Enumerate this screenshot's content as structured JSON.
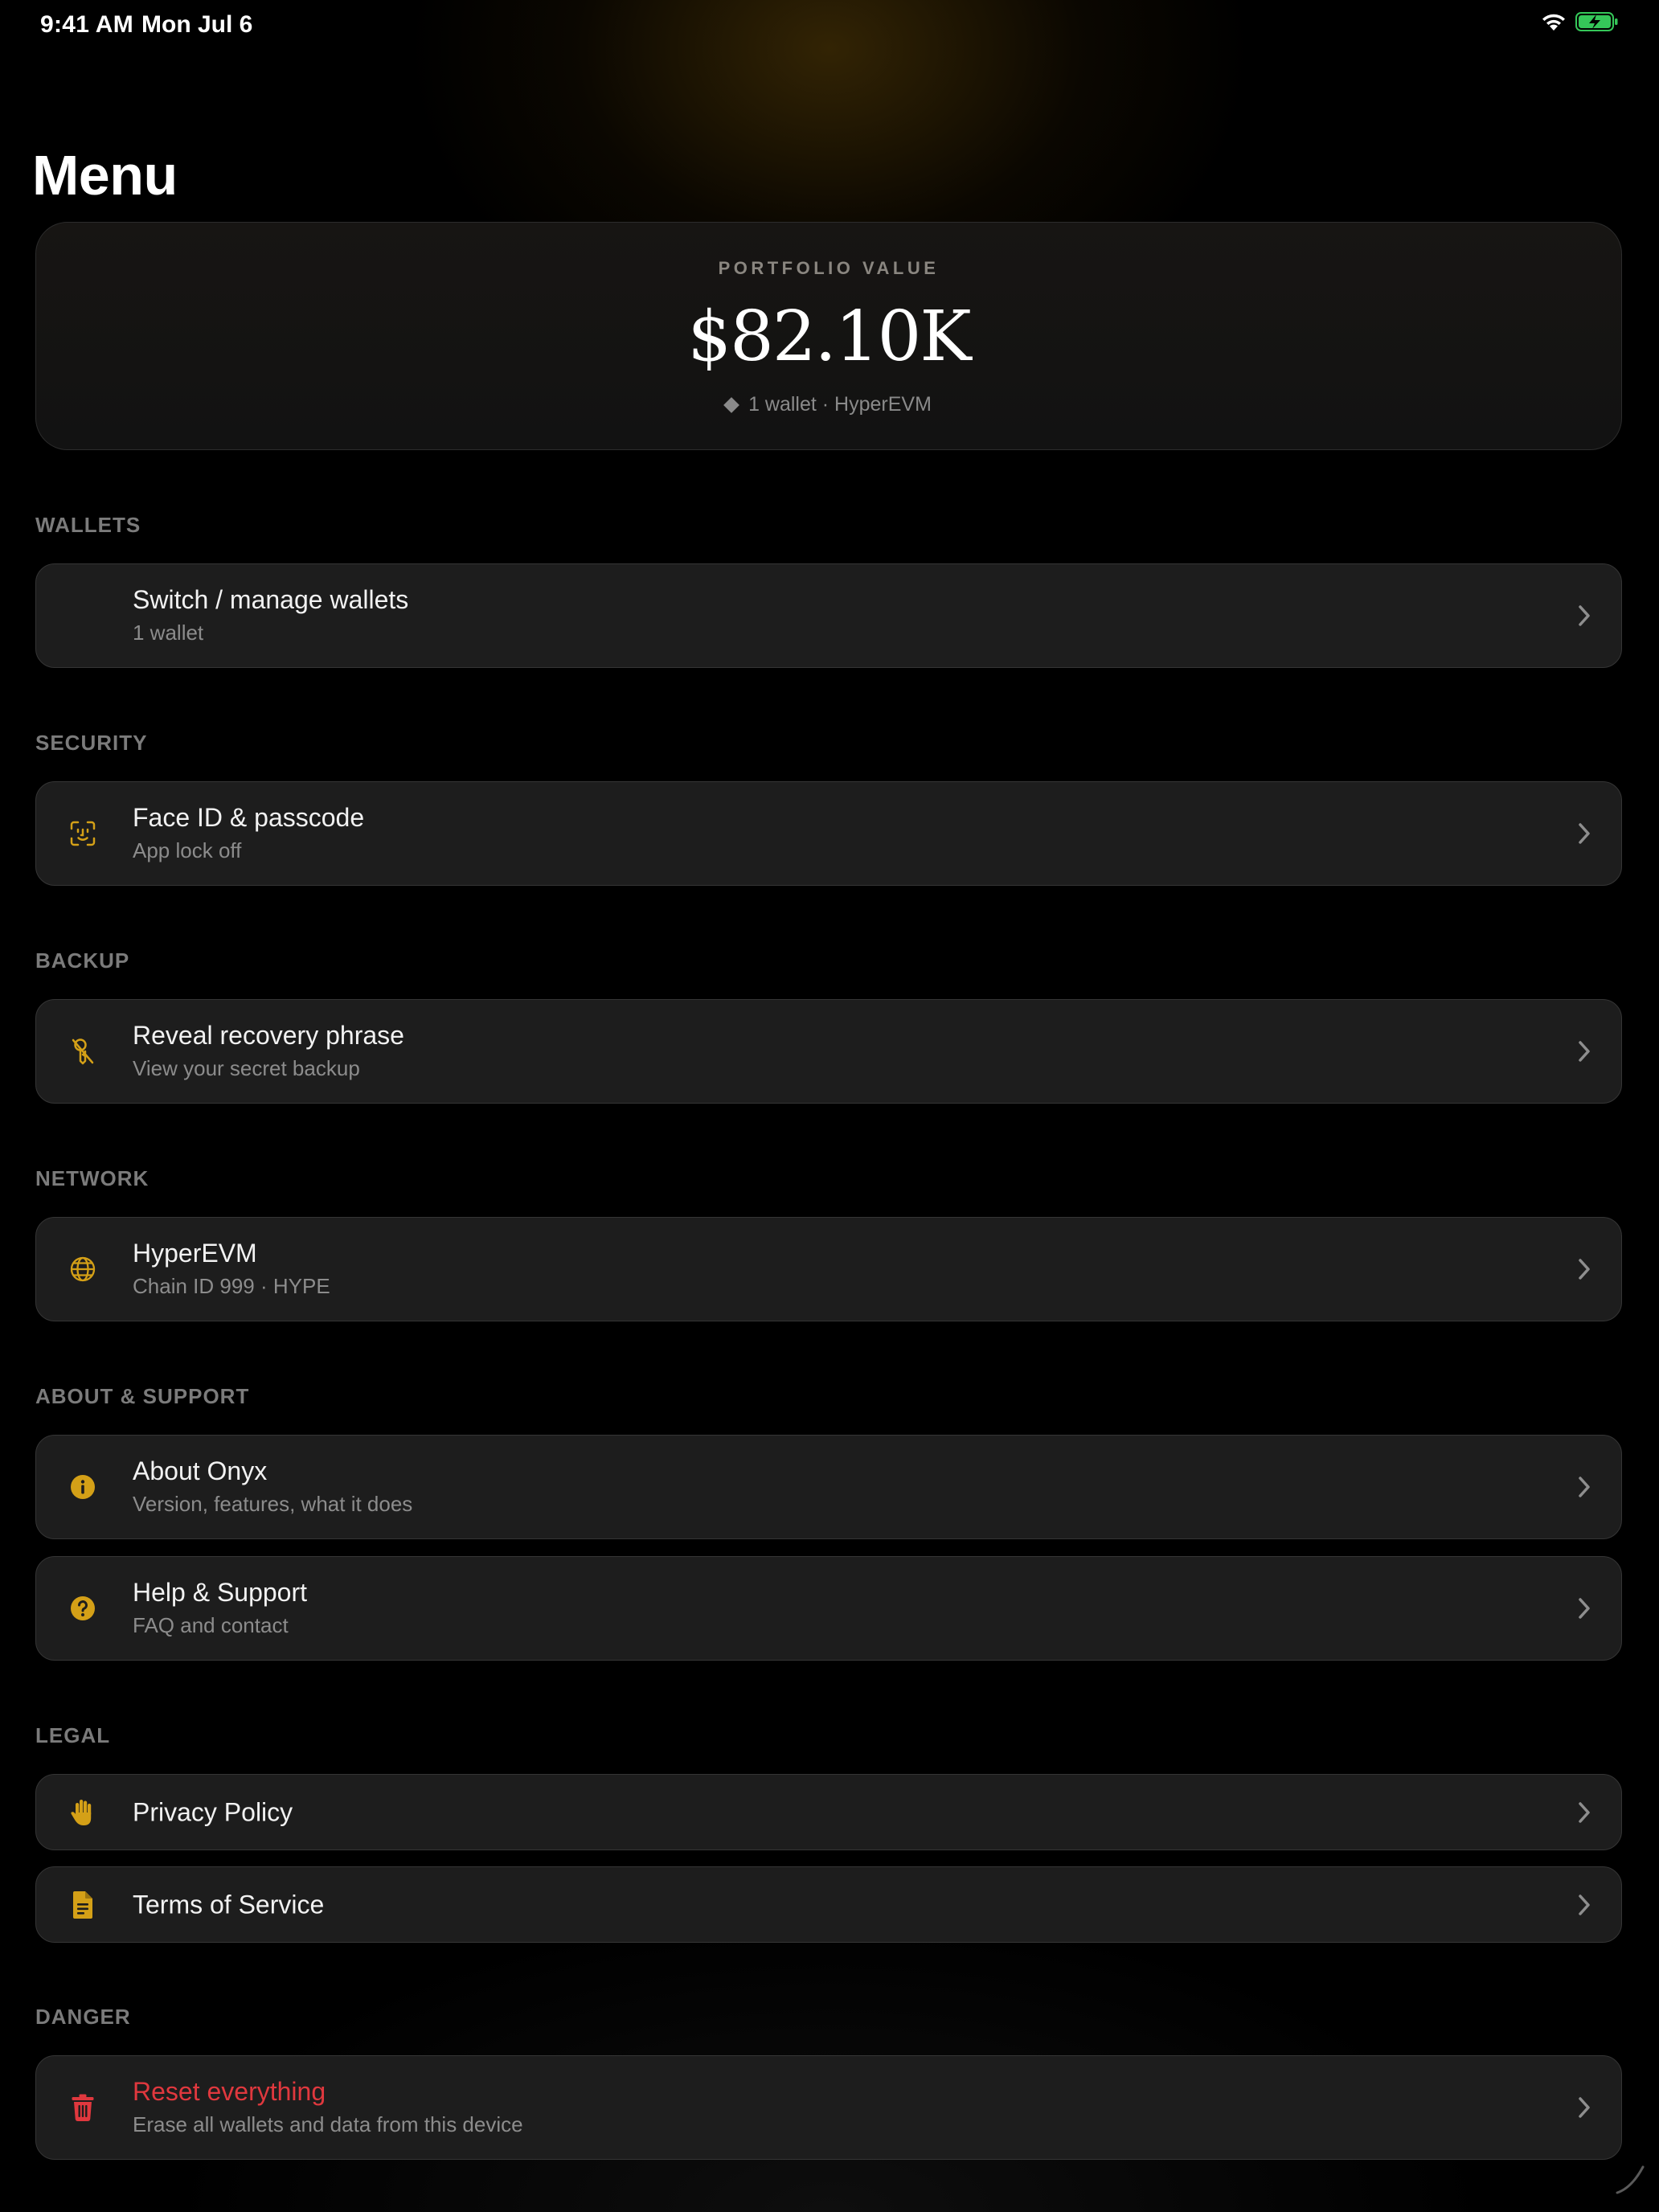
{
  "status_bar": {
    "time": "9:41 AM",
    "date": "Mon Jul 6"
  },
  "page_title": "Menu",
  "portfolio": {
    "label": "PORTFOLIO VALUE",
    "value": "$82.10K",
    "subtitle": "1 wallet · HyperEVM"
  },
  "colors": {
    "accent": "#d4a017",
    "danger": "#e0383e",
    "background": "#000000",
    "card": "#1d1d1d"
  },
  "sections": {
    "wallets": {
      "label": "WALLETS",
      "items": [
        {
          "title": "Switch / manage wallets",
          "subtitle": "1 wallet",
          "icon": "none"
        }
      ]
    },
    "security": {
      "label": "SECURITY",
      "items": [
        {
          "title": "Face ID & passcode",
          "subtitle": "App lock off",
          "icon": "face-id-icon"
        }
      ]
    },
    "backup": {
      "label": "BACKUP",
      "items": [
        {
          "title": "Reveal recovery phrase",
          "subtitle": "View your secret backup",
          "icon": "key-slash-icon"
        }
      ]
    },
    "network": {
      "label": "NETWORK",
      "items": [
        {
          "title": "HyperEVM",
          "subtitle": "Chain ID 999 · HYPE",
          "icon": "globe-icon"
        }
      ]
    },
    "about": {
      "label": "ABOUT & SUPPORT",
      "items": [
        {
          "title": "About Onyx",
          "subtitle": "Version, features, what it does",
          "icon": "info-icon"
        },
        {
          "title": "Help & Support",
          "subtitle": "FAQ and contact",
          "icon": "question-icon"
        }
      ]
    },
    "legal": {
      "label": "LEGAL",
      "items": [
        {
          "title": "Privacy Policy",
          "icon": "hand-icon"
        },
        {
          "title": "Terms of Service",
          "icon": "document-icon"
        }
      ]
    },
    "danger": {
      "label": "DANGER",
      "items": [
        {
          "title": "Reset everything",
          "subtitle": "Erase all wallets and data from this device",
          "icon": "trash-icon"
        }
      ]
    }
  }
}
